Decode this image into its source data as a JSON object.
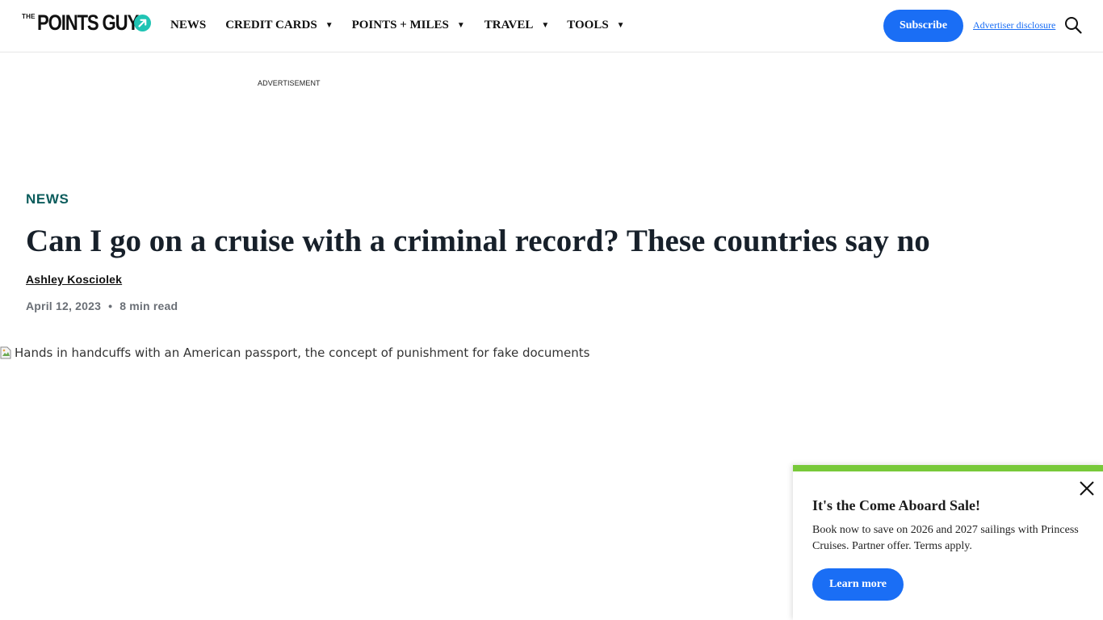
{
  "header": {
    "logo": {
      "prefix": "THE",
      "name": "POINTS GUY",
      "badge_icon": "arrow-up-right-icon"
    },
    "nav": [
      {
        "label": "NEWS",
        "has_dropdown": false
      },
      {
        "label": "CREDIT CARDS",
        "has_dropdown": true
      },
      {
        "label": "POINTS + MILES",
        "has_dropdown": true
      },
      {
        "label": "TRAVEL",
        "has_dropdown": true
      },
      {
        "label": "TOOLS",
        "has_dropdown": true
      }
    ],
    "dropdown_caret": "▼",
    "subscribe_label": "Subscribe",
    "advertiser_disclosure": "Advertiser disclosure",
    "search_icon": "search-icon"
  },
  "ad": {
    "label": "ADVERTISEMENT"
  },
  "article": {
    "category": "NEWS",
    "title": "Can I go on a cruise with a criminal record? These countries say no",
    "author": "Ashley Kosciolek",
    "date": "April 12, 2023",
    "separator": "•",
    "read_time": "8 min read",
    "hero_alt": "Hands in handcuffs with an American passport, the concept of punishment for fake documents"
  },
  "promo": {
    "title": "It's the Come Aboard Sale!",
    "body": "Book now to save on 2026 and 2027 sailings with Princess Cruises. Partner offer. Terms apply.",
    "button_label": "Learn more",
    "close_icon": "close-icon"
  },
  "colors": {
    "brand_blue": "#1a6ef5",
    "teal_category": "#0b5c5c",
    "promo_bar_green": "#78c93a",
    "logo_badge_teal": "#20c4b4"
  }
}
